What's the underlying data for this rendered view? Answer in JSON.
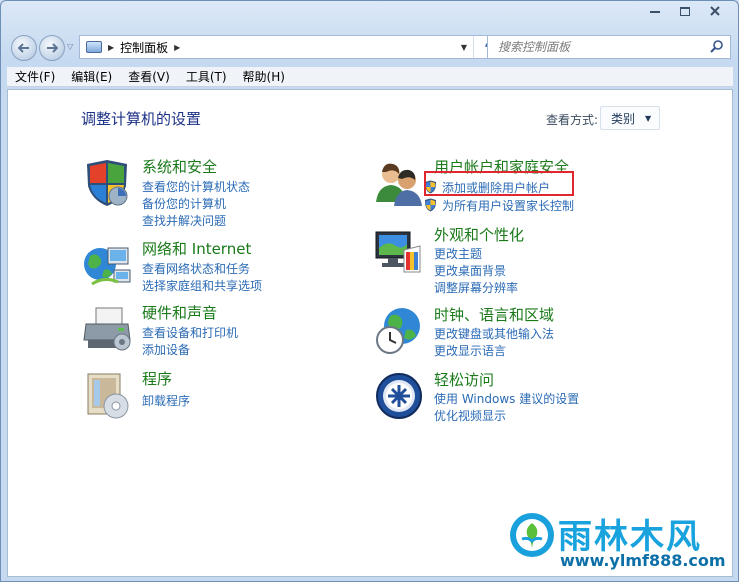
{
  "window": {
    "caption": {
      "minimize": "▬",
      "close": "✕"
    }
  },
  "address": {
    "path": "控制面板",
    "search_placeholder": "搜索控制面板"
  },
  "menu": [
    "文件(F)",
    "编辑(E)",
    "查看(V)",
    "工具(T)",
    "帮助(H)"
  ],
  "main": {
    "title": "调整计算机的设置",
    "view_by_label": "查看方式:",
    "view_by_value": "类别"
  },
  "categories": {
    "system_security": {
      "title": "系统和安全",
      "icon": "shield-icon",
      "links": [
        "查看您的计算机状态",
        "备份您的计算机",
        "查找并解决问题"
      ]
    },
    "network": {
      "title": "网络和 Internet",
      "icon": "network-globe-icon",
      "links": [
        "查看网络状态和任务",
        "选择家庭组和共享选项"
      ]
    },
    "hardware": {
      "title": "硬件和声音",
      "icon": "printer-icon",
      "links": [
        "查看设备和打印机",
        "添加设备"
      ]
    },
    "programs": {
      "title": "程序",
      "icon": "programs-icon",
      "links": [
        "卸载程序"
      ]
    },
    "user_accounts": {
      "title": "用户帐户和家庭安全",
      "icon": "users-icon",
      "links": [
        "添加或删除用户帐户",
        "为所有用户设置家长控制"
      ]
    },
    "appearance": {
      "title": "外观和个性化",
      "icon": "monitor-palette-icon",
      "links": [
        "更改主题",
        "更改桌面背景",
        "调整屏幕分辨率"
      ]
    },
    "clock": {
      "title": "时钟、语言和区域",
      "icon": "globe-clock-icon",
      "links": [
        "更改键盘或其他输入法",
        "更改显示语言"
      ]
    },
    "ease": {
      "title": "轻松访问",
      "icon": "ease-of-access-icon",
      "links": [
        "使用 Windows 建议的设置",
        "优化视频显示"
      ]
    }
  },
  "watermark": {
    "name": "雨林木风",
    "url": "www.ylmf888.com"
  },
  "colors": {
    "category_title": "#1a7a1a",
    "link": "#2b6bb5",
    "highlight": "#e0262e"
  }
}
